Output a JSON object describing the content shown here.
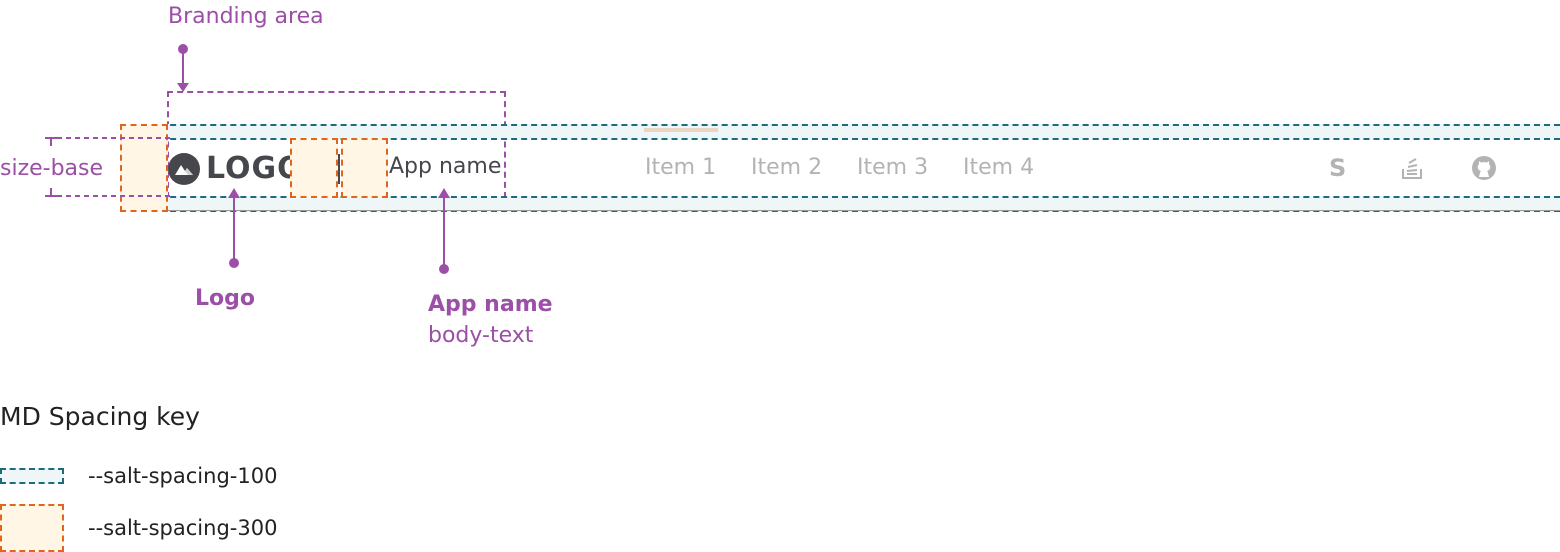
{
  "annotations": {
    "branding_area": "Branding area",
    "size_base": "size-base",
    "logo": "Logo",
    "app_name": "App name",
    "app_name_sub": "body-text"
  },
  "header": {
    "logo_text": "LOGO",
    "logo_icon": "mountain-icon",
    "app_name": "App name",
    "nav_items": [
      {
        "label": "Item 1",
        "active": true
      },
      {
        "label": "Item 2",
        "active": false
      },
      {
        "label": "Item 3",
        "active": false
      },
      {
        "label": "Item 4",
        "active": false
      }
    ],
    "utility_icons": [
      "salt-s-icon",
      "stack-overflow-icon",
      "github-icon"
    ]
  },
  "key": {
    "title": "MD Spacing key",
    "items": [
      {
        "label": "--salt-spacing-100",
        "style": "teal-dashed"
      },
      {
        "label": "--salt-spacing-300",
        "style": "orange-dashed"
      }
    ]
  },
  "colors": {
    "annotation": "#9b4fa6",
    "spacing_100": "#1c6b7f",
    "spacing_300": "#e0661e",
    "spacing_300_fill": "#fff6e6",
    "active_indicator": "#e8d5c4",
    "nav_text": "#b3b3b3",
    "logo": "#45474d"
  }
}
